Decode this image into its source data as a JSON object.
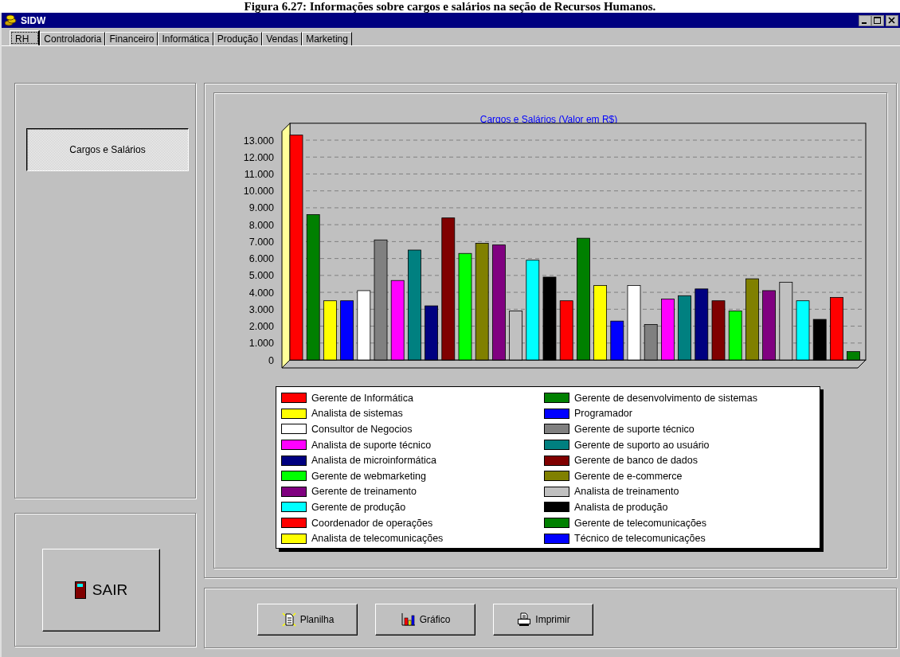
{
  "caption": "Figura 6.27: Informações sobre cargos e salários na seção de Recursos Humanos.",
  "window": {
    "title": "SIDW"
  },
  "tabs": [
    {
      "label": "RH",
      "selected": true
    },
    {
      "label": "Controladoria",
      "selected": false
    },
    {
      "label": "Financeiro",
      "selected": false
    },
    {
      "label": "Informática",
      "selected": false
    },
    {
      "label": "Produção",
      "selected": false
    },
    {
      "label": "Vendas",
      "selected": false
    },
    {
      "label": "Marketing",
      "selected": false
    }
  ],
  "sidebar": {
    "items": [
      {
        "label": "Cargos e Salários",
        "selected": true
      }
    ]
  },
  "exit_button": {
    "label": "SAIR"
  },
  "chart_panel": {
    "chart_data": {
      "type": "bar",
      "title": "Cargos e Salários (Valor em R$)",
      "grid": true,
      "ylim": [
        0,
        14
      ],
      "yticks": [
        {
          "value": 0,
          "label": "0"
        },
        {
          "value": 1,
          "label": "1.000"
        },
        {
          "value": 2,
          "label": "2.000"
        },
        {
          "value": 3,
          "label": "3.000"
        },
        {
          "value": 4,
          "label": "4.000"
        },
        {
          "value": 5,
          "label": "5.000"
        },
        {
          "value": 6,
          "label": "6.000"
        },
        {
          "value": 7,
          "label": "7.000"
        },
        {
          "value": 8,
          "label": "8.000"
        },
        {
          "value": 9,
          "label": "9.000"
        },
        {
          "value": 10,
          "label": "10.000"
        },
        {
          "value": 11,
          "label": "11.000"
        },
        {
          "value": 12,
          "label": "12.000"
        },
        {
          "value": 13,
          "label": "13.000"
        }
      ],
      "values": [
        13.3,
        8.6,
        3.5,
        3.5,
        4.1,
        7.1,
        4.7,
        6.5,
        3.2,
        8.4,
        6.3,
        6.9,
        6.8,
        2.9,
        5.9,
        4.9,
        3.5,
        7.2,
        4.4,
        2.3,
        4.4,
        2.1,
        3.6,
        3.8,
        4.2,
        3.5,
        2.9,
        4.8,
        4.1,
        4.6,
        3.5,
        2.4,
        3.7,
        0.5
      ]
    },
    "legend": [
      {
        "label": "Gerente de Informática",
        "color": "#ff0000"
      },
      {
        "label": "Gerente de desenvolvimento de sistemas",
        "color": "#008000"
      },
      {
        "label": "Analista de sistemas",
        "color": "#ffff00"
      },
      {
        "label": "Programador",
        "color": "#0000ff"
      },
      {
        "label": "Consultor de Negocios",
        "color": "#ffffff"
      },
      {
        "label": "Gerente de suporte técnico",
        "color": "#808080"
      },
      {
        "label": "Analista de suporte técnico",
        "color": "#ff00ff"
      },
      {
        "label": "Gerente de suporto ao usuário",
        "color": "#008080"
      },
      {
        "label": "Analista de microinformática",
        "color": "#000080"
      },
      {
        "label": "Gerente de banco de dados",
        "color": "#800000"
      },
      {
        "label": "Gerente de webmarketing",
        "color": "#00ff00"
      },
      {
        "label": "Gerente de e-commerce",
        "color": "#808000"
      },
      {
        "label": "Gerente de treinamento",
        "color": "#800080"
      },
      {
        "label": "Analista de treinamento",
        "color": "#c0c0c0"
      },
      {
        "label": "Gerente de produção",
        "color": "#00ffff"
      },
      {
        "label": "Analista de produção",
        "color": "#000000"
      },
      {
        "label": "Coordenador de operações",
        "color": "#ff0000"
      },
      {
        "label": "Gerente de telecomunicações",
        "color": "#008000"
      },
      {
        "label": "Analista de telecomunicações",
        "color": "#ffff00"
      },
      {
        "label": "Técnico de telecomunicações",
        "color": "#0000ff"
      }
    ]
  },
  "toolbar": {
    "buttons": [
      {
        "label": "Planilha",
        "kind": "sheet"
      },
      {
        "label": "Gráfico",
        "kind": "chart"
      },
      {
        "label": "Imprimir",
        "kind": "print"
      }
    ]
  }
}
